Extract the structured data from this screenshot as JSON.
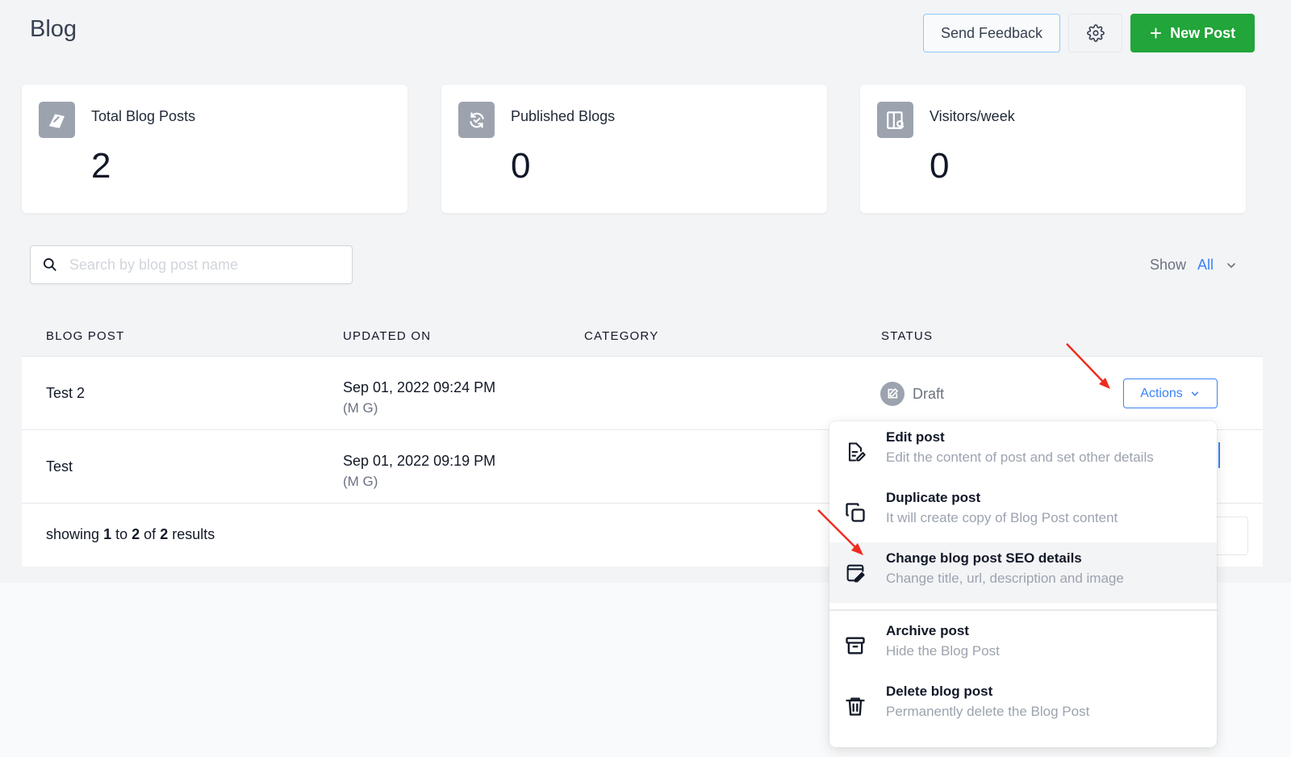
{
  "header": {
    "title": "Blog",
    "send_feedback": "Send Feedback",
    "new_post": "New Post"
  },
  "stats": [
    {
      "label": "Total Blog Posts",
      "value": "2"
    },
    {
      "label": "Published Blogs",
      "value": "0"
    },
    {
      "label": "Visitors/week",
      "value": "0"
    }
  ],
  "search": {
    "placeholder": "Search by blog post name"
  },
  "filter": {
    "label": "Show",
    "value": "All"
  },
  "table": {
    "columns": [
      "BLOG POST",
      "UPDATED ON",
      "CATEGORY",
      "STATUS"
    ],
    "rows": [
      {
        "name": "Test 2",
        "updated": "Sep 01, 2022 09:24 PM",
        "by": "(M G)",
        "category": "",
        "status": "Draft",
        "actions": "Actions"
      },
      {
        "name": "Test",
        "updated": "Sep 01, 2022 09:19 PM",
        "by": "(M G)",
        "category": "",
        "status": "",
        "actions": ""
      }
    ],
    "footer": {
      "prefix": "showing",
      "from": "1",
      "to_word": "to",
      "to": "2",
      "of_word": "of",
      "total": "2",
      "suffix": "results"
    }
  },
  "actions_menu": [
    {
      "title": "Edit post",
      "desc": "Edit the content of post and set other details",
      "icon": "edit-doc-icon"
    },
    {
      "title": "Duplicate post",
      "desc": "It will create copy of Blog Post content",
      "icon": "copy-icon"
    },
    {
      "title": "Change blog post SEO details",
      "desc": "Change title, url, description and image",
      "icon": "seo-edit-icon"
    },
    {
      "title": "Archive post",
      "desc": "Hide the Blog Post",
      "icon": "archive-icon"
    },
    {
      "title": "Delete blog post",
      "desc": "Permanently delete the Blog Post",
      "icon": "trash-icon"
    }
  ],
  "colors": {
    "primary": "#22a53a",
    "accent": "#3b82f6",
    "annotation": "#ef2b1f"
  }
}
